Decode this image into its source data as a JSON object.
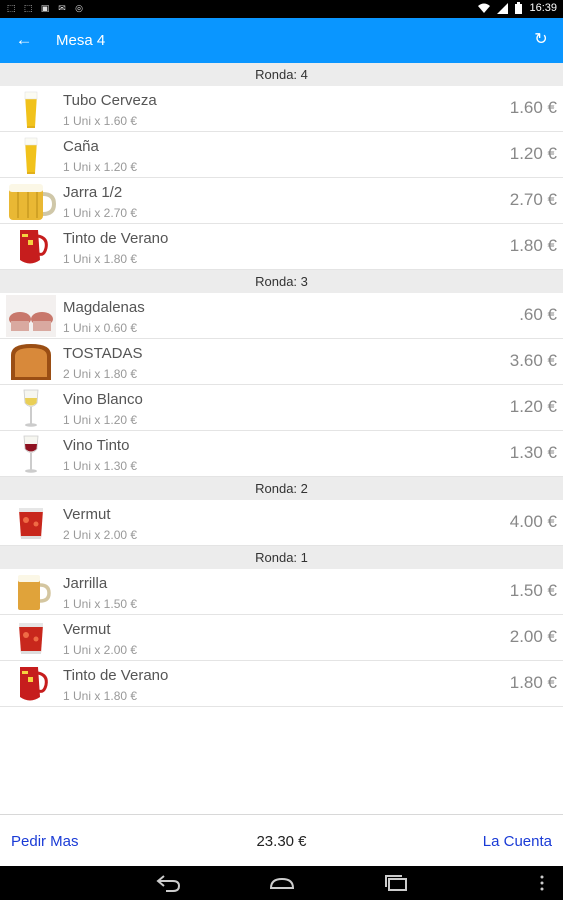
{
  "status_bar": {
    "time": "16:39",
    "left_icons": [
      "notification-icon",
      "notification-icon",
      "image-icon",
      "mail-icon",
      "sync-icon"
    ],
    "right_icons": [
      "wifi-icon",
      "signal-icon",
      "battery-icon"
    ]
  },
  "app_bar": {
    "title": "Mesa 4",
    "back_icon": "arrow-left-icon",
    "refresh_icon": "refresh-icon"
  },
  "colors": {
    "app_bar": "#0a96ff",
    "link": "#1a3bd6",
    "round_header": "#ececec"
  },
  "rounds": [
    {
      "label": "Ronda: 4",
      "items": [
        {
          "name": "Tubo Cerveza",
          "qty": "1 Uni x 1.60 €",
          "price": "1.60 €",
          "icon": "beer-tube"
        },
        {
          "name": "Caña",
          "qty": "1 Uni x 1.20 €",
          "price": "1.20 €",
          "icon": "beer-tube"
        },
        {
          "name": "Jarra 1/2",
          "qty": "1 Uni x 2.70 €",
          "price": "2.70 €",
          "icon": "beer-jug"
        },
        {
          "name": "Tinto de Verano",
          "qty": "1 Uni x 1.80 €",
          "price": "1.80 €",
          "icon": "red-pitcher"
        }
      ]
    },
    {
      "label": "Ronda: 3",
      "items": [
        {
          "name": "Magdalenas",
          "qty": "1 Uni x 0.60 €",
          "price": ".60 €",
          "icon": "muffins"
        },
        {
          "name": "TOSTADAS",
          "qty": "2 Uni x 1.80 €",
          "price": "3.60 €",
          "icon": "toast"
        },
        {
          "name": "Vino Blanco",
          "qty": "1 Uni x 1.20 €",
          "price": "1.20 €",
          "icon": "white-wine"
        },
        {
          "name": "Vino Tinto",
          "qty": "1 Uni x 1.30 €",
          "price": "1.30 €",
          "icon": "red-wine"
        }
      ]
    },
    {
      "label": "Ronda: 2",
      "items": [
        {
          "name": "Vermut",
          "qty": "2 Uni x 2.00 €",
          "price": "4.00 €",
          "icon": "vermouth"
        }
      ]
    },
    {
      "label": "Ronda: 1",
      "items": [
        {
          "name": "Jarrilla",
          "qty": "1 Uni x 1.50 €",
          "price": "1.50 €",
          "icon": "beer-mug"
        },
        {
          "name": "Vermut",
          "qty": "1 Uni x 2.00 €",
          "price": "2.00 €",
          "icon": "vermouth"
        },
        {
          "name": "Tinto de Verano",
          "qty": "1 Uni x 1.80 €",
          "price": "1.80 €",
          "icon": "red-pitcher"
        }
      ]
    }
  ],
  "footer": {
    "order_more": "Pedir Mas",
    "total": "23.30 €",
    "bill": "La Cuenta"
  },
  "nav_bar": {
    "icons": [
      "back-icon",
      "home-icon",
      "recents-icon",
      "menu-icon"
    ]
  }
}
